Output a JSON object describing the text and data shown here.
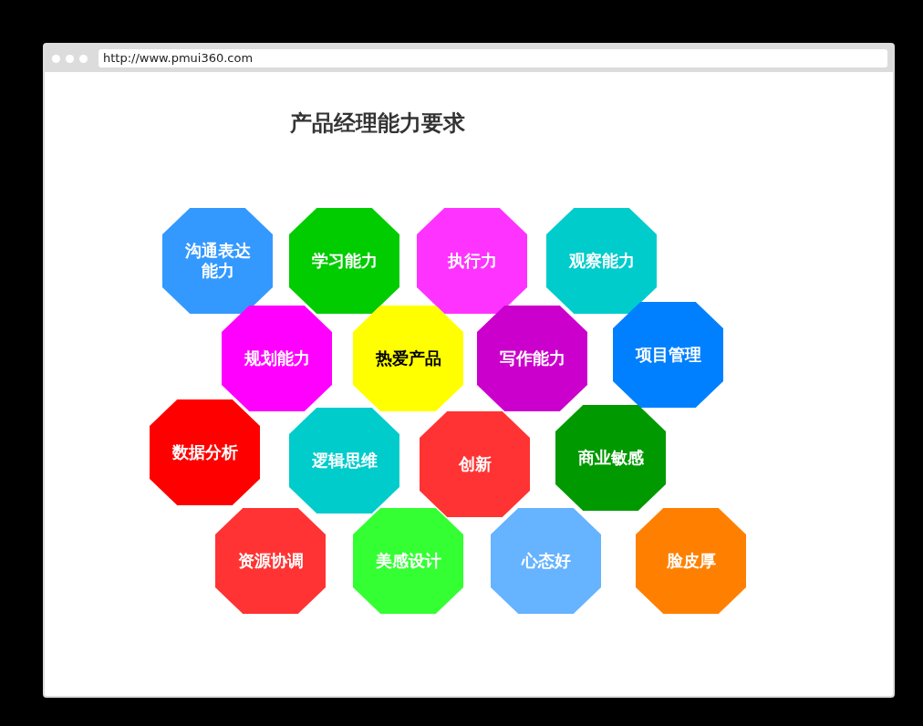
{
  "browser": {
    "url": "http://www.pmui360.com"
  },
  "title": "产品经理能力要求",
  "skills": [
    {
      "label": "沟通表达能力",
      "color": "#3399ff"
    },
    {
      "label": "学习能力",
      "color": "#00cc00"
    },
    {
      "label": "执行力",
      "color": "#ff33ff"
    },
    {
      "label": "观察能力",
      "color": "#00cccc"
    },
    {
      "label": "规划能力",
      "color": "#ff00ff"
    },
    {
      "label": "热爱产品",
      "color": "#ffff00"
    },
    {
      "label": "写作能力",
      "color": "#cc00cc"
    },
    {
      "label": "项目管理",
      "color": "#0080ff"
    },
    {
      "label": "数据分析",
      "color": "#ff0000"
    },
    {
      "label": "逻辑思维",
      "color": "#00cccc"
    },
    {
      "label": "创新",
      "color": "#ff3333"
    },
    {
      "label": "商业敏感",
      "color": "#009900"
    },
    {
      "label": "资源协调",
      "color": "#ff3333"
    },
    {
      "label": "美感设计",
      "color": "#33ff33"
    },
    {
      "label": "心态好",
      "color": "#66b3ff"
    },
    {
      "label": "脸皮厚",
      "color": "#ff8000"
    }
  ]
}
